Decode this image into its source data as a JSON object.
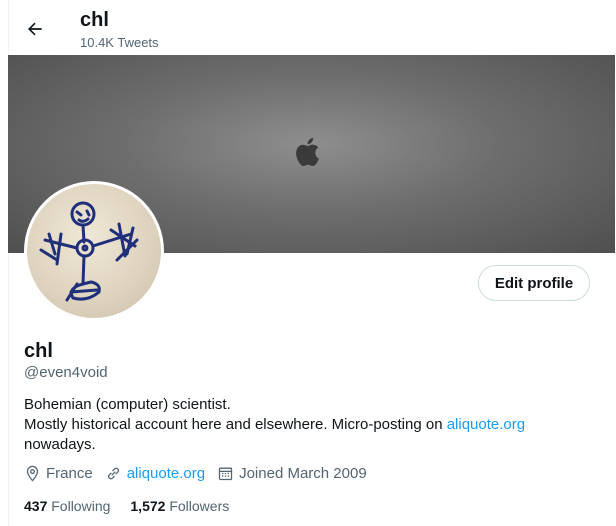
{
  "header": {
    "name": "chl",
    "tweet_count": "10.4K Tweets"
  },
  "profile": {
    "name": "chl",
    "handle": "@even4void",
    "edit_label": "Edit profile",
    "bio_line1": "Bohemian (computer) scientist.",
    "bio_line2_pre": "Mostly historical account here and elsewhere. Micro-posting on ",
    "bio_link": "aliquote.org",
    "bio_line3": "nowadays.",
    "location": "France",
    "website": "aliquote.org",
    "joined": "Joined March 2009"
  },
  "stats": {
    "following_count": "437",
    "following_label": "Following",
    "followers_count": "1,572",
    "followers_label": "Followers"
  },
  "icons": [
    "back-arrow-icon",
    "apple-logo-icon",
    "location-icon",
    "link-icon",
    "calendar-icon"
  ],
  "colors": {
    "accent": "#1d9bf0",
    "text": "#0f1419",
    "muted": "#536471"
  }
}
